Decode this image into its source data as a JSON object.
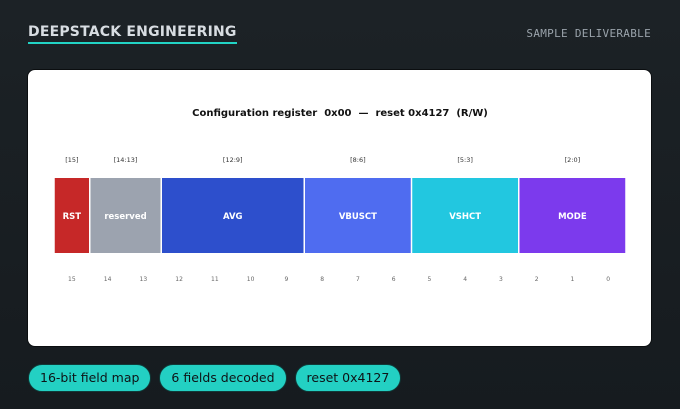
{
  "header": {
    "brand": "DEEPSTACK ENGINEERING",
    "tagline": "SAMPLE DELIVERABLE"
  },
  "register": {
    "title": "Configuration register  0x00  —  reset 0x4127  (R/W)",
    "total_bits": 16,
    "fields": [
      {
        "name": "RST",
        "range": "[15]",
        "msb": 15,
        "lsb": 15,
        "color": "#c62828"
      },
      {
        "name": "reserved",
        "range": "[14:13]",
        "msb": 14,
        "lsb": 13,
        "color": "#9ca3af"
      },
      {
        "name": "AVG",
        "range": "[12:9]",
        "msb": 12,
        "lsb": 9,
        "color": "#2d4fcc"
      },
      {
        "name": "VBUSCT",
        "range": "[8:6]",
        "msb": 8,
        "lsb": 6,
        "color": "#4f6cf0"
      },
      {
        "name": "VSHCT",
        "range": "[5:3]",
        "msb": 5,
        "lsb": 3,
        "color": "#22c7e0"
      },
      {
        "name": "MODE",
        "range": "[2:0]",
        "msb": 2,
        "lsb": 0,
        "color": "#7c3aed"
      }
    ],
    "bit_labels": [
      "15",
      "14",
      "13",
      "12",
      "11",
      "10",
      "9",
      "8",
      "7",
      "6",
      "5",
      "4",
      "3",
      "2",
      "1",
      "0"
    ]
  },
  "chips": [
    "16-bit field map",
    "6 fields decoded",
    "reset 0x4127"
  ]
}
